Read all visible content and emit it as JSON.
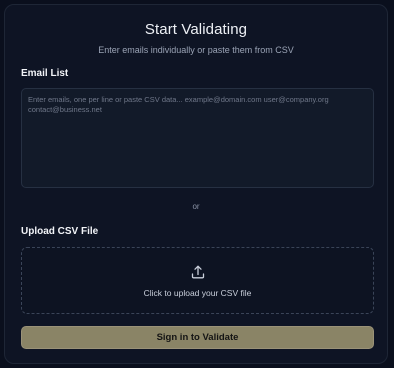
{
  "header": {
    "title": "Start Validating",
    "subtitle": "Enter emails individually or paste them from CSV"
  },
  "email_list": {
    "label": "Email List",
    "placeholder": "Enter emails, one per line or paste CSV data... example@domain.com user@company.org contact@business.net",
    "value": ""
  },
  "divider": {
    "text": "or"
  },
  "upload": {
    "label": "Upload CSV File",
    "dropzone_text": "Click to upload your CSV file",
    "icon": "upload-icon"
  },
  "submit": {
    "label": "Sign in to Validate"
  },
  "colors": {
    "background": "#0a0f1d",
    "card": "#0e1424",
    "button": "#8a8466",
    "muted_text": "#9aa3b5"
  }
}
